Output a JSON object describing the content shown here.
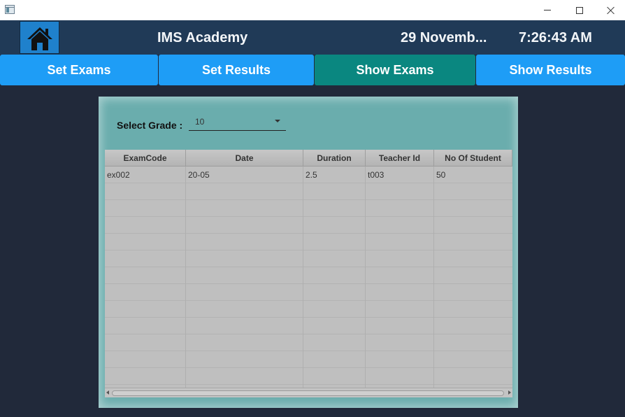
{
  "window": {
    "icons": {
      "app": "app-icon",
      "minimize": "minimize-icon",
      "maximize": "maximize-icon",
      "close": "close-icon"
    }
  },
  "header": {
    "title": "IMS Academy",
    "date": "29 Novemb...",
    "time": "7:26:43 AM",
    "home_icon": "home-icon"
  },
  "nav": {
    "tabs": [
      {
        "label": "Set Exams"
      },
      {
        "label": "Set Results"
      },
      {
        "label": "Show Exams",
        "active": true
      },
      {
        "label": "Show Results"
      }
    ]
  },
  "filter": {
    "label": "Select Grade :",
    "value": "10"
  },
  "table": {
    "columns": [
      "ExamCode",
      "Date",
      "Duration",
      "Teacher Id",
      "No Of Student"
    ],
    "rows": [
      [
        "ex002",
        "20-05",
        "2.5",
        "t003",
        "50"
      ]
    ]
  },
  "colors": {
    "header_bg": "#203a57",
    "tab": "#1e9df6",
    "tab_active": "#0a8780",
    "panel": "#6aadad",
    "background": "#21293a"
  }
}
